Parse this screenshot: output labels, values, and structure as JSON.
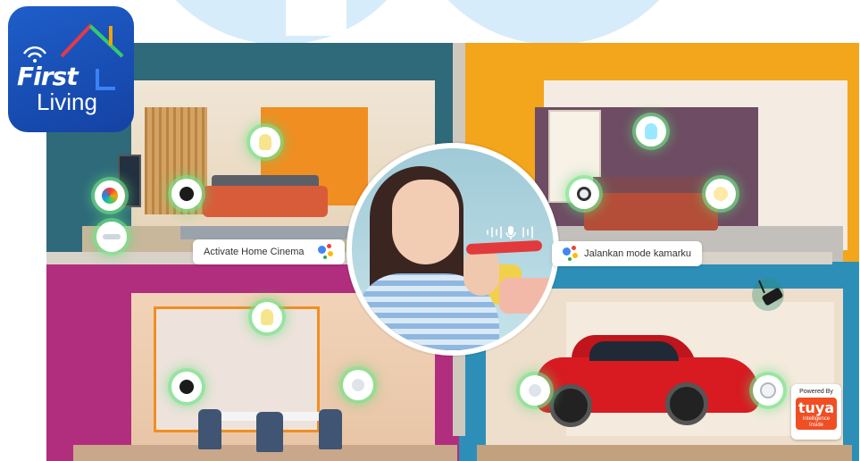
{
  "brand": {
    "logo_line1": "First",
    "logo_line2": "Living",
    "logo_colors": [
      "#1e5ec9",
      "#ffffff",
      "#e63946",
      "#f4a300",
      "#2ecc71"
    ]
  },
  "voice_commands": {
    "left": "Activate Home Cinema",
    "right": "Jalankan mode kamarku"
  },
  "assistant_icon": "google-assistant-icon",
  "devices": {
    "living_room": [
      "smart-switch-icon",
      "smart-plug-icon",
      "smart-bulb-icon",
      "ir-remote-icon"
    ],
    "bedroom": [
      "security-camera-icon",
      "smart-bulb-icon",
      "bedside-lamp-icon"
    ],
    "dining_room": [
      "smart-bulb-icon",
      "smart-speaker-icon",
      "motion-sensor-icon"
    ],
    "garage": [
      "door-sensor-icon",
      "smoke-detector-icon",
      "outdoor-camera-icon"
    ]
  },
  "partner_badge": {
    "powered_by": "Powered By",
    "name": "tuya",
    "tagline": "Intelligence Inside"
  },
  "colors": {
    "device_glow": "#5ddc78",
    "tuya_orange": "#f04e23",
    "car_red": "#d81a21"
  }
}
